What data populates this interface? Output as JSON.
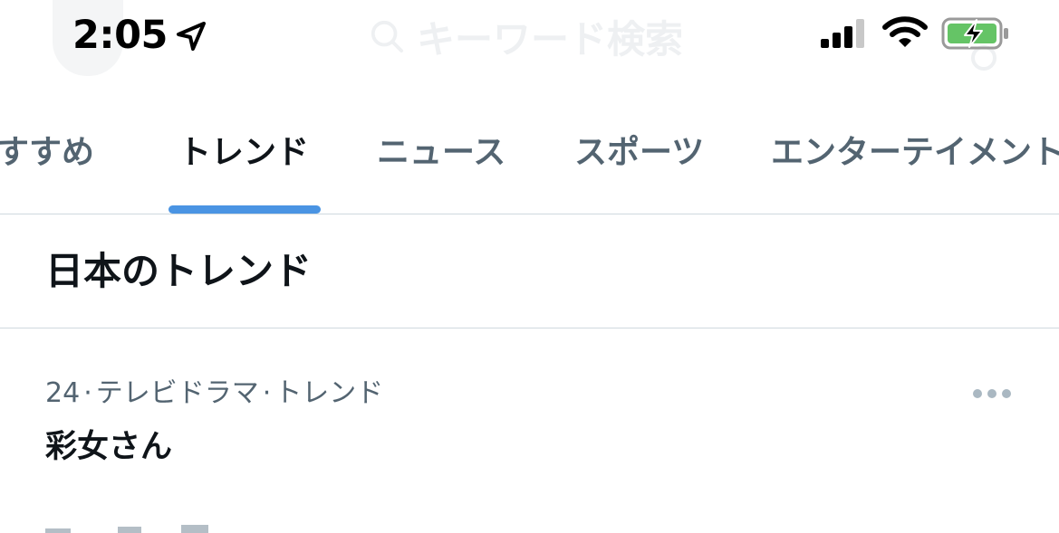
{
  "status_bar": {
    "time": "2:05",
    "icons": [
      "location-arrow-icon",
      "cellular-signal-icon",
      "wifi-icon",
      "battery-charging-icon"
    ]
  },
  "header": {
    "search_placeholder": "キーワード検索"
  },
  "tabs": [
    {
      "label": "すすめ",
      "active": false
    },
    {
      "label": "トレンド",
      "active": true
    },
    {
      "label": "ニュース",
      "active": false
    },
    {
      "label": "スポーツ",
      "active": false
    },
    {
      "label": "エンターテイメント",
      "active": false
    }
  ],
  "section": {
    "title": "日本のトレンド"
  },
  "trends": [
    {
      "rank": "24",
      "category": "テレビドラマ",
      "suffix": "トレンド",
      "name": "彩女さん"
    }
  ],
  "colors": {
    "accent": "#4a94e3",
    "text_primary": "#0f1419",
    "text_secondary": "#536471",
    "divider": "#cfd9de",
    "battery_fill": "#65c466"
  }
}
